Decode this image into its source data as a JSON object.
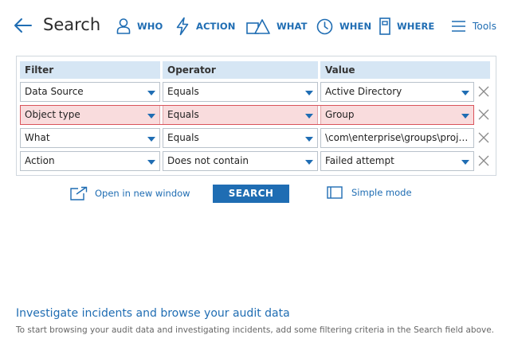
{
  "header": {
    "title": "Search",
    "nav": [
      {
        "key": "who",
        "label": "WHO",
        "icon": "user-icon"
      },
      {
        "key": "action",
        "label": "ACTION",
        "icon": "lightning-icon"
      },
      {
        "key": "what",
        "label": "WHAT",
        "icon": "shapes-icon"
      },
      {
        "key": "when",
        "label": "WHEN",
        "icon": "clock-icon"
      },
      {
        "key": "where",
        "label": "WHERE",
        "icon": "server-icon"
      }
    ],
    "tools_label": "Tools"
  },
  "filters": {
    "columns": {
      "filter": "Filter",
      "operator": "Operator",
      "value": "Value"
    },
    "rows": [
      {
        "filter": "Data Source",
        "operator": "Equals",
        "value": "Active Directory",
        "highlighted": false
      },
      {
        "filter": "Object type",
        "operator": "Equals",
        "value": "Group",
        "highlighted": true
      },
      {
        "filter": "What",
        "operator": "Equals",
        "value": "\\com\\enterprise\\groups\\project...",
        "highlighted": false
      },
      {
        "filter": "Action",
        "operator": "Does not contain",
        "value": "Failed attempt",
        "highlighted": false
      }
    ]
  },
  "actions": {
    "open_new_window": "Open in new window",
    "search": "SEARCH",
    "simple_mode": "Simple mode"
  },
  "investigate": {
    "title": "Investigate incidents and browse your audit data",
    "text": "To start browsing your audit data and investigating incidents, add some filtering criteria in the Search field above."
  },
  "colors": {
    "accent": "#1f6db3",
    "header_bg": "#d6e6f4",
    "highlight_bg": "#f9dcdd",
    "highlight_border": "#d9535b"
  }
}
